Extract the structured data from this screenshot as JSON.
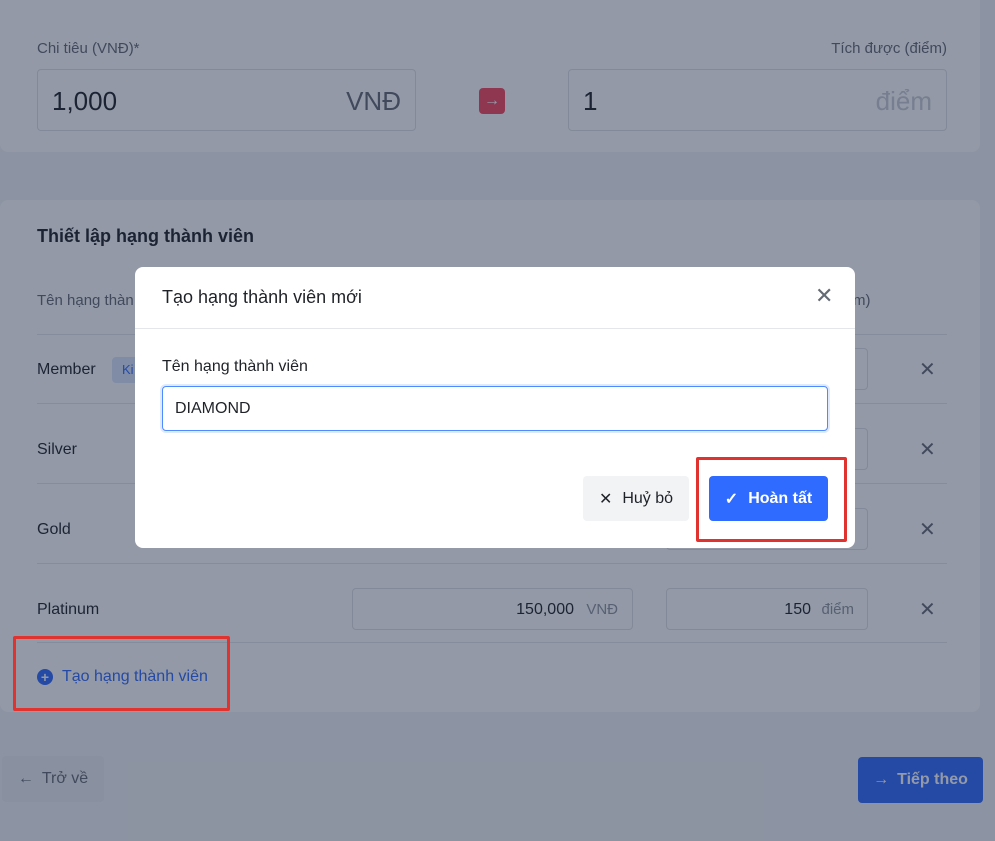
{
  "conversion": {
    "spend_label": "Chi tiêu (VNĐ)*",
    "spend_value": "1,000",
    "spend_unit": "VNĐ",
    "earn_label": "Tích được (điểm)",
    "earn_value": "1",
    "earn_unit": "điểm"
  },
  "tiers": {
    "section_title": "Thiết lập hạng thành viên",
    "col_name_header": "Tên hạng thàn",
    "col_points_header_tail": "m)",
    "default_badge": "Ki",
    "rows": [
      {
        "name": "Member"
      },
      {
        "name": "Silver"
      },
      {
        "name": "Gold"
      },
      {
        "name": "Platinum",
        "spend_value": "150,000",
        "spend_unit": "VNĐ",
        "points_value": "150",
        "points_unit": "điểm"
      }
    ],
    "add_label": "Tạo hạng thành viên"
  },
  "nav": {
    "back_label": "Trở về",
    "next_label": "Tiếp theo"
  },
  "modal": {
    "title": "Tạo hạng thành viên mới",
    "field_label": "Tên hạng thành viên",
    "field_value": "DIAMOND",
    "cancel_label": "Huỷ bỏ",
    "done_label": "Hoàn tất"
  },
  "colors": {
    "primary": "#2f6bff",
    "highlight": "#e0322f",
    "arrow_accent": "#f7475f"
  }
}
